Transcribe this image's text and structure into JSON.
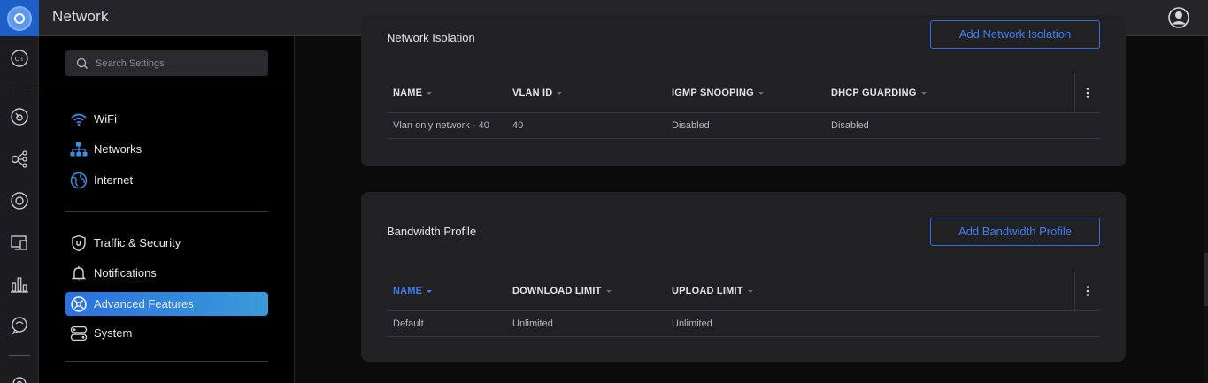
{
  "app": {
    "title": "Network"
  },
  "colors": {
    "accent": "#3d7ff2",
    "brand": "#1d5fc7",
    "active_start": "#2a72e0",
    "active_end": "#3a9bd8"
  },
  "rail": {
    "items": [
      {
        "name": "ot-device-icon",
        "glyph": "OT"
      },
      {
        "name": "dashboard-icon"
      },
      {
        "name": "topology-icon"
      },
      {
        "name": "devices-icon"
      },
      {
        "name": "clients-icon"
      },
      {
        "name": "statistics-icon"
      },
      {
        "name": "insights-icon"
      },
      {
        "name": "settings-icon"
      }
    ]
  },
  "search": {
    "placeholder": "Search Settings",
    "value": ""
  },
  "nav": {
    "group1": [
      {
        "label": "WiFi",
        "icon": "wifi-icon"
      },
      {
        "label": "Networks",
        "icon": "networks-icon"
      },
      {
        "label": "Internet",
        "icon": "internet-globe-icon"
      }
    ],
    "group2": [
      {
        "label": "Traffic & Security",
        "icon": "shield-icon"
      },
      {
        "label": "Notifications",
        "icon": "bell-icon"
      },
      {
        "label": "Advanced Features",
        "icon": "advanced-features-icon",
        "active": true
      },
      {
        "label": "System",
        "icon": "system-icon"
      }
    ]
  },
  "network_isolation": {
    "title": "Network Isolation",
    "add_button": "Add Network Isolation",
    "columns": [
      "NAME",
      "VLAN ID",
      "IGMP SNOOPING",
      "DHCP GUARDING"
    ],
    "rows": [
      [
        "Vlan only network - 40",
        "40",
        "Disabled",
        "Disabled"
      ]
    ]
  },
  "bandwidth_profile": {
    "title": "Bandwidth Profile",
    "add_button": "Add Bandwidth Profile",
    "columns": [
      "NAME",
      "DOWNLOAD LIMIT",
      "UPLOAD LIMIT"
    ],
    "rows": [
      [
        "Default",
        "Unlimited",
        "Unlimited"
      ]
    ]
  }
}
